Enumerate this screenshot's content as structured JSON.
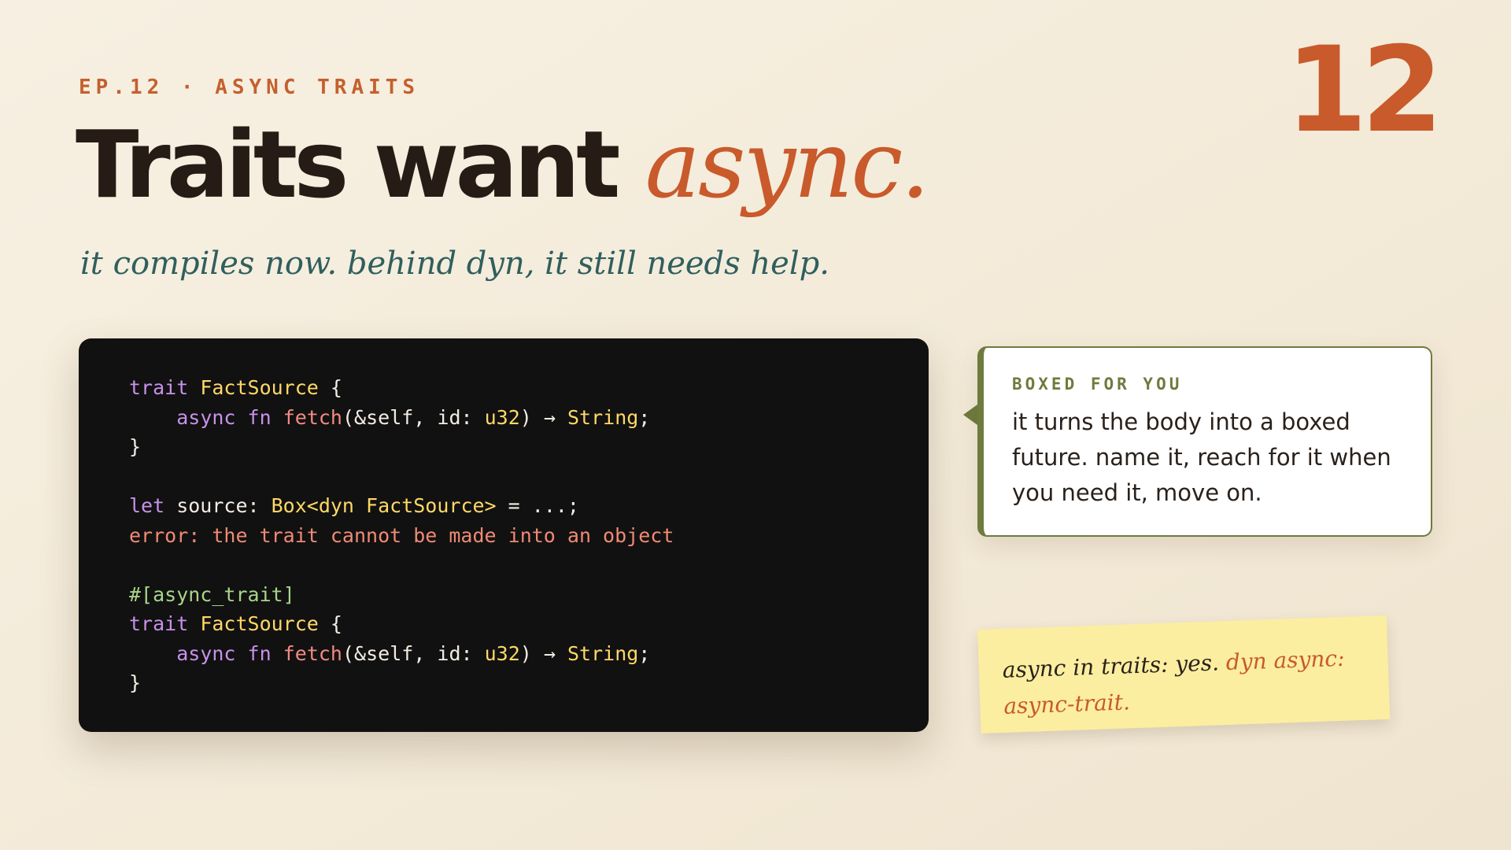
{
  "kicker": "EP.12 · ASYNC TRAITS",
  "episode_number": "12",
  "headline": {
    "main": "Traits want ",
    "accent": "async."
  },
  "subtitle": "it compiles now. behind dyn, it still needs help.",
  "code": {
    "block1": {
      "l1_kw": "trait",
      "l1_type": "FactSource",
      "l1_rest": " {",
      "l2_kw": "async",
      "l2_fn_kw": "fn",
      "l2_fn": "fetch",
      "l2_args": "(&self, id: ",
      "l2_argtype": "u32",
      "l2_arrow": ") → ",
      "l2_ret": "String",
      "l2_end": ";",
      "l3": "}"
    },
    "block2": {
      "let_kw": "let",
      "let_rest": " source: ",
      "let_type": "Box<dyn FactSource>",
      "let_end": " = ...;",
      "error": "error: the trait cannot be made into an object"
    },
    "block3": {
      "attr": "#[async_trait]",
      "l1_kw": "trait",
      "l1_type": "FactSource",
      "l1_rest": " {",
      "l2_kw": "async",
      "l2_fn_kw": "fn",
      "l2_fn": "fetch",
      "l2_args": "(&self, id: ",
      "l2_argtype": "u32",
      "l2_arrow": ") → ",
      "l2_ret": "String",
      "l2_end": ";",
      "l3": "}"
    }
  },
  "callout": {
    "label": "BOXED FOR YOU",
    "body": "it turns the body into a boxed future. name it, reach for it when you need it, move on."
  },
  "sticky_note": {
    "text": "async in traits: yes. ",
    "highlight": "dyn async: async-trait."
  },
  "colors": {
    "accent": "#c95a2b",
    "ink": "#261c15",
    "teal": "#2f5f5e",
    "olive": "#6e7b3e",
    "code_bg": "#111111",
    "sticky": "#fbeea0"
  }
}
